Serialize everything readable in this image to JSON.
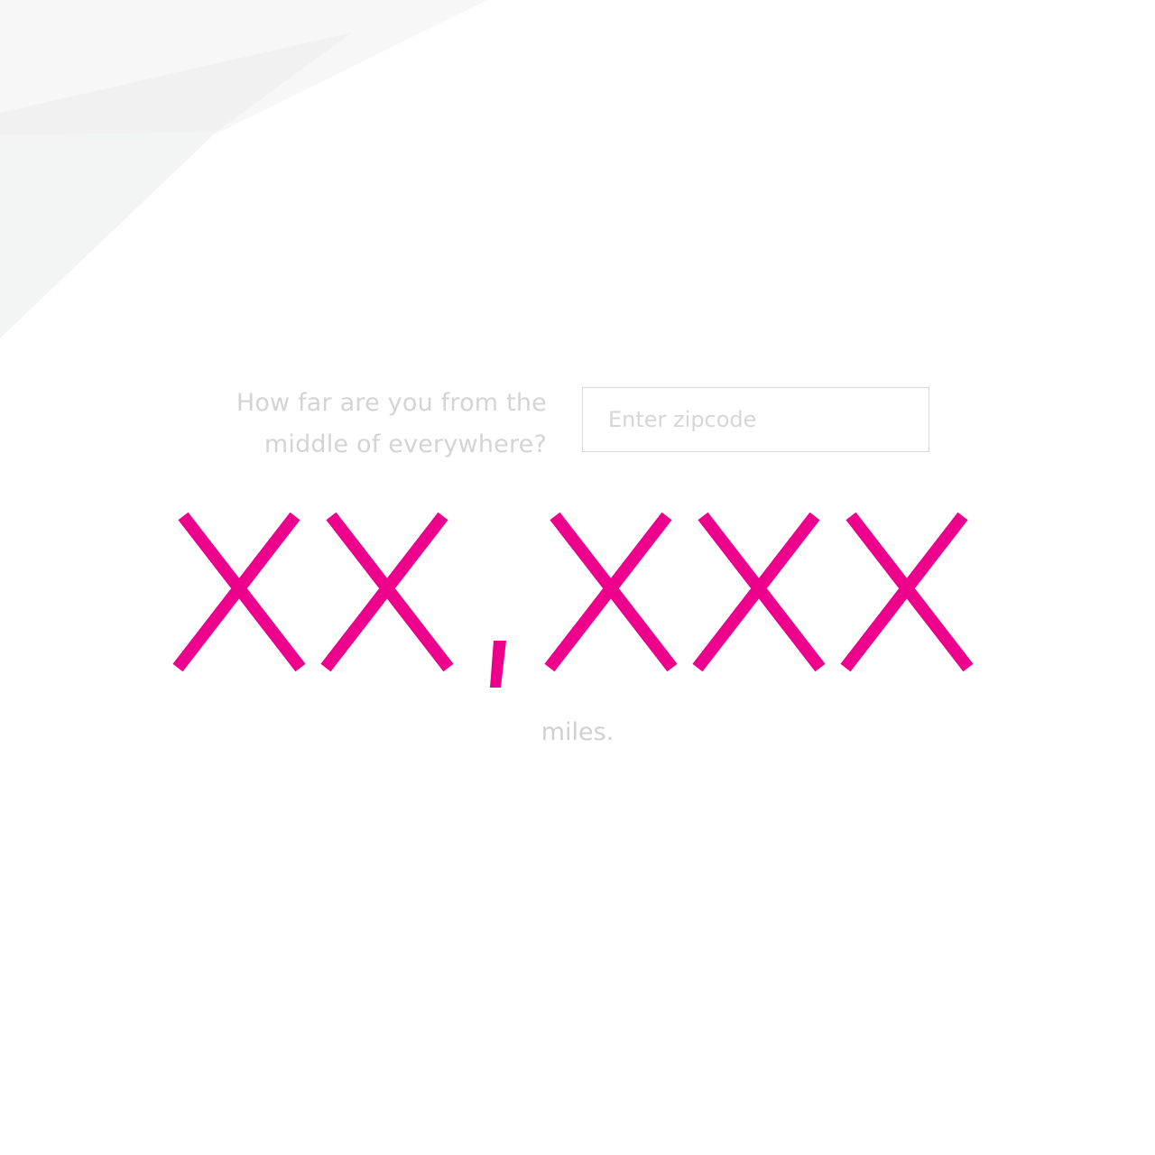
{
  "prompt": {
    "line1": "How far are you from the",
    "line2": "middle of everywhere?"
  },
  "zip_input": {
    "placeholder": "Enter zipcode",
    "value": ""
  },
  "result": {
    "distance": "XX,XXX",
    "unit": "miles."
  },
  "colors": {
    "accent": "#EC008C",
    "muted_text": "#D4D4D4",
    "input_border": "#DADADA",
    "background": "#FFFFFF",
    "shape_light": "#F6F6F6",
    "shape_mid": "#F0F1F1"
  }
}
